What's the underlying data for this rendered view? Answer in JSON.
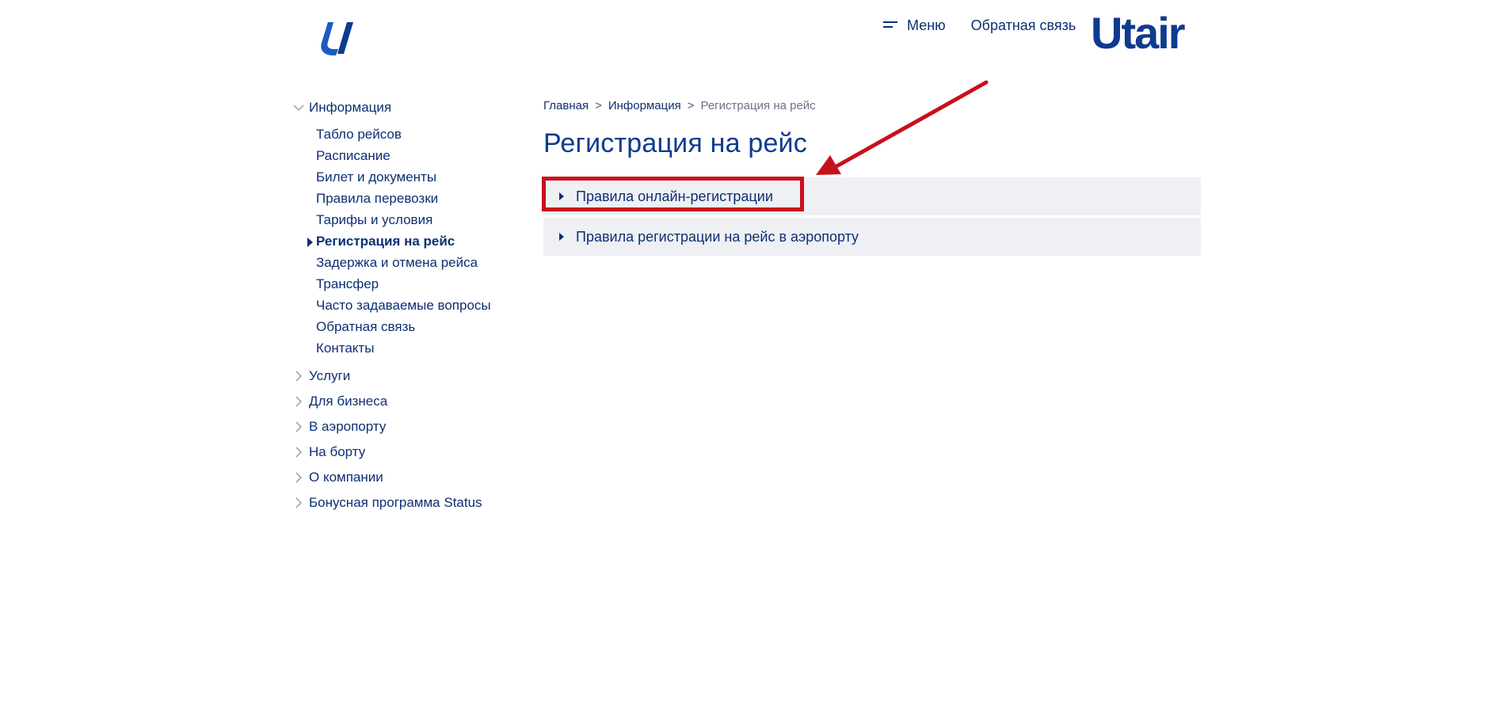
{
  "header": {
    "menu_label": "Меню",
    "feedback_label": "Обратная связь",
    "brand_word": "Utair",
    "logo_icon": "utair-u-logo-icon"
  },
  "sidebar": {
    "information": {
      "label": "Информация",
      "items": [
        {
          "label": "Табло рейсов",
          "active": false
        },
        {
          "label": "Расписание",
          "active": false
        },
        {
          "label": "Билет и документы",
          "active": false
        },
        {
          "label": "Правила перевозки",
          "active": false
        },
        {
          "label": "Тарифы и условия",
          "active": false
        },
        {
          "label": "Регистрация на рейс",
          "active": true
        },
        {
          "label": "Задержка и отмена рейса",
          "active": false
        },
        {
          "label": "Трансфер",
          "active": false
        },
        {
          "label": "Часто задаваемые вопросы",
          "active": false
        },
        {
          "label": "Обратная связь",
          "active": false
        },
        {
          "label": "Контакты",
          "active": false
        }
      ]
    },
    "sections": [
      {
        "label": "Услуги"
      },
      {
        "label": "Для бизнеса"
      },
      {
        "label": "В аэропорту"
      },
      {
        "label": "На борту"
      },
      {
        "label": "О компании"
      },
      {
        "label": "Бонусная программа Status"
      }
    ]
  },
  "breadcrumb": {
    "home": "Главная",
    "sep1": ">",
    "section": "Информация",
    "sep2": ">",
    "current": "Регистрация на рейс"
  },
  "main": {
    "title": "Регистрация на рейс",
    "accordion": [
      {
        "label": "Правила онлайн-регистрации"
      },
      {
        "label": "Правила регистрации на рейс в аэропорту"
      }
    ]
  },
  "colors": {
    "brand": "#0d3b8f",
    "text": "#0d2f73",
    "accordion_bg": "#eef0f4",
    "annotation": "#c8101b"
  }
}
